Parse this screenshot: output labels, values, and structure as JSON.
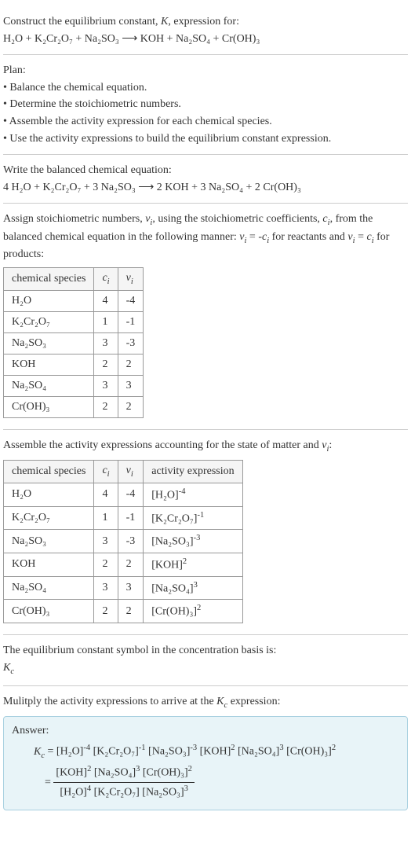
{
  "intro": {
    "title": "Construct the equilibrium constant, K, expression for:",
    "equation": "H₂O + K₂Cr₂O₇ + Na₂SO₃ ⟶ KOH + Na₂SO₄ + Cr(OH)₃"
  },
  "plan": {
    "label": "Plan:",
    "items": [
      "• Balance the chemical equation.",
      "• Determine the stoichiometric numbers.",
      "• Assemble the activity expression for each chemical species.",
      "• Use the activity expressions to build the equilibrium constant expression."
    ]
  },
  "balanced": {
    "label": "Write the balanced chemical equation:",
    "equation": "4 H₂O + K₂Cr₂O₇ + 3 Na₂SO₃ ⟶ 2 KOH + 3 Na₂SO₄ + 2 Cr(OH)₃"
  },
  "stoich": {
    "text": "Assign stoichiometric numbers, νᵢ, using the stoichiometric coefficients, cᵢ, from the balanced chemical equation in the following manner: νᵢ = -cᵢ for reactants and νᵢ = cᵢ for products:",
    "table": {
      "headers": [
        "chemical species",
        "cᵢ",
        "νᵢ"
      ],
      "rows": [
        [
          "H₂O",
          "4",
          "-4"
        ],
        [
          "K₂Cr₂O₇",
          "1",
          "-1"
        ],
        [
          "Na₂SO₃",
          "3",
          "-3"
        ],
        [
          "KOH",
          "2",
          "2"
        ],
        [
          "Na₂SO₄",
          "3",
          "3"
        ],
        [
          "Cr(OH)₃",
          "2",
          "2"
        ]
      ]
    }
  },
  "activity": {
    "text": "Assemble the activity expressions accounting for the state of matter and νᵢ:",
    "table": {
      "headers": [
        "chemical species",
        "cᵢ",
        "νᵢ",
        "activity expression"
      ],
      "rows": [
        {
          "species": "H₂O",
          "c": "4",
          "v": "-4",
          "expr_base": "[H₂O]",
          "expr_exp": "-4"
        },
        {
          "species": "K₂Cr₂O₇",
          "c": "1",
          "v": "-1",
          "expr_base": "[K₂Cr₂O₇]",
          "expr_exp": "-1"
        },
        {
          "species": "Na₂SO₃",
          "c": "3",
          "v": "-3",
          "expr_base": "[Na₂SO₃]",
          "expr_exp": "-3"
        },
        {
          "species": "KOH",
          "c": "2",
          "v": "2",
          "expr_base": "[KOH]",
          "expr_exp": "2"
        },
        {
          "species": "Na₂SO₄",
          "c": "3",
          "v": "3",
          "expr_base": "[Na₂SO₄]",
          "expr_exp": "3"
        },
        {
          "species": "Cr(OH)₃",
          "c": "2",
          "v": "2",
          "expr_base": "[Cr(OH)₃]",
          "expr_exp": "2"
        }
      ]
    }
  },
  "symbol": {
    "text": "The equilibrium constant symbol in the concentration basis is:",
    "sym": "K꜀"
  },
  "multiply": {
    "text": "Mulitply the activity expressions to arrive at the K꜀ expression:"
  },
  "answer": {
    "label": "Answer:",
    "lhs": "K꜀ = ",
    "prod_terms": [
      {
        "base": "[H₂O]",
        "exp": "-4"
      },
      {
        "base": "[K₂Cr₂O₇]",
        "exp": "-1"
      },
      {
        "base": "[Na₂SO₃]",
        "exp": "-3"
      },
      {
        "base": "[KOH]",
        "exp": "2"
      },
      {
        "base": "[Na₂SO₄]",
        "exp": "3"
      },
      {
        "base": "[Cr(OH)₃]",
        "exp": "2"
      }
    ],
    "eq": "= ",
    "frac": {
      "num": [
        {
          "base": "[KOH]",
          "exp": "2"
        },
        {
          "base": "[Na₂SO₄]",
          "exp": "3"
        },
        {
          "base": "[Cr(OH)₃]",
          "exp": "2"
        }
      ],
      "den": [
        {
          "base": "[H₂O]",
          "exp": "4"
        },
        {
          "base": "[K₂Cr₂O₇]",
          "exp": ""
        },
        {
          "base": "[Na₂SO₃]",
          "exp": "3"
        }
      ]
    }
  }
}
